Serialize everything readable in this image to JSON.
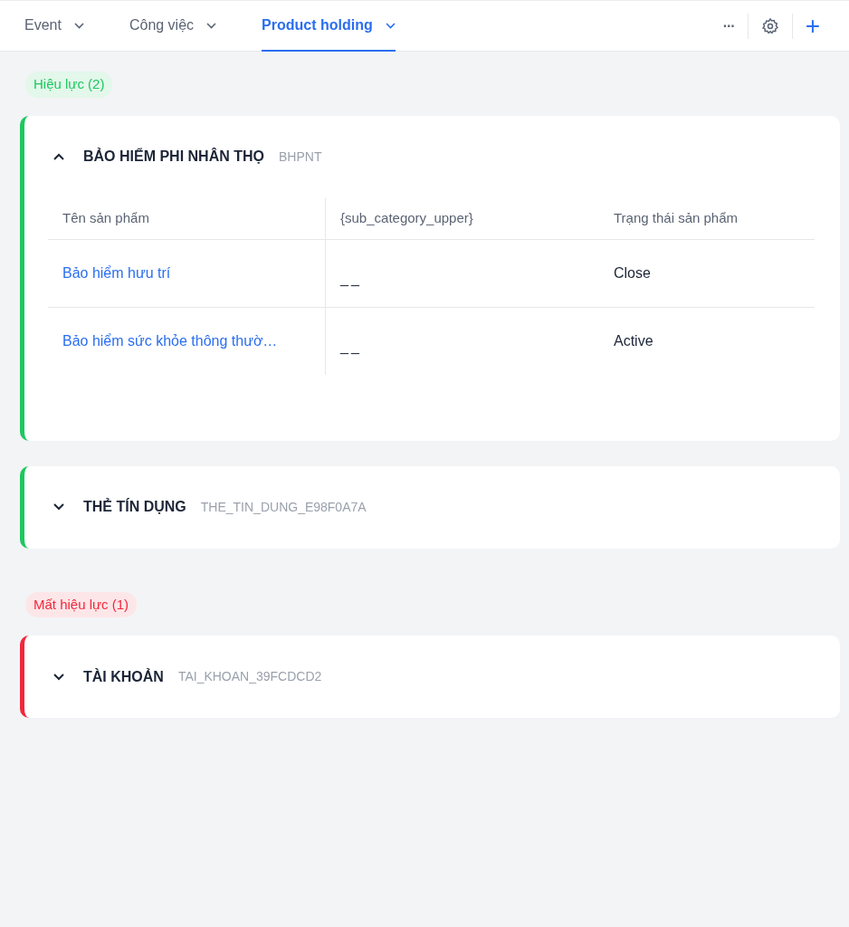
{
  "tabs": [
    {
      "label": "Event",
      "selected": false
    },
    {
      "label": "Công việc",
      "selected": false
    },
    {
      "label": "Product holding",
      "selected": true
    }
  ],
  "toolbar": {
    "more": "···",
    "add": "+"
  },
  "groups": [
    {
      "label": "Hiệu lực (2)",
      "kind": "active",
      "color": "#1ec760",
      "cards": [
        {
          "title": "BẢO HIỂM PHI NHÂN THỌ",
          "code": "BHPNT",
          "expanded": true,
          "table": {
            "columns": [
              "Tên sản phẩm",
              "{sub_category_upper}",
              "Trạng thái sản phẩm"
            ],
            "rows": [
              [
                "Bảo hiểm hưu trí",
                "__",
                "Close"
              ],
              [
                "Bảo hiểm sức khỏe thông thườ…",
                "__",
                "Active"
              ]
            ]
          }
        },
        {
          "title": "THẺ TÍN DỤNG",
          "code": "THE_TIN_DUNG_E98F0A7A",
          "expanded": false
        }
      ]
    },
    {
      "label": "Mất hiệu lực (1)",
      "kind": "inactive",
      "color": "#f0283c",
      "cards": [
        {
          "title": "TÀI KHOẢN",
          "code": "TAI_KHOAN_39FCDCD2",
          "expanded": false
        }
      ]
    }
  ]
}
